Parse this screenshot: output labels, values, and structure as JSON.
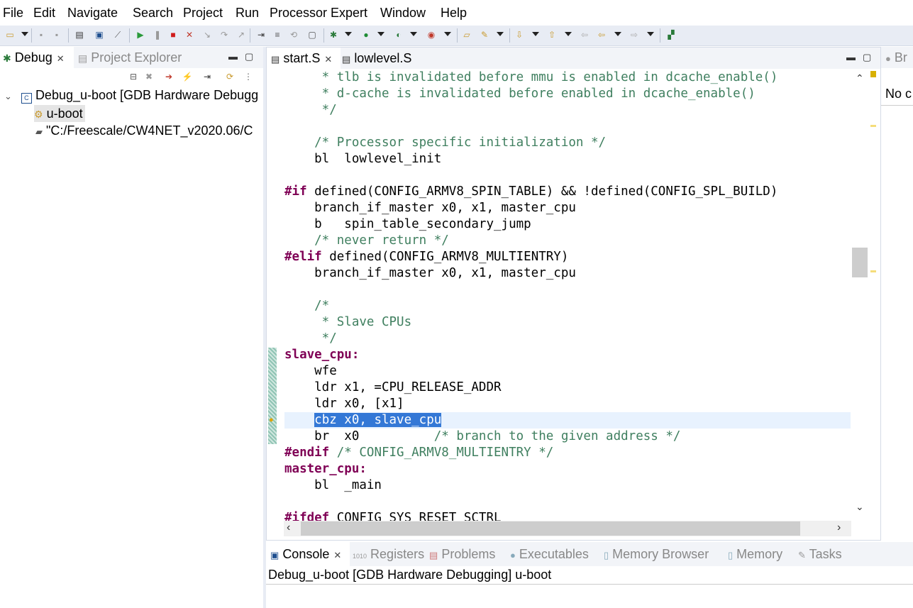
{
  "menu": [
    "File",
    "Edit",
    "Navigate",
    "Search",
    "Project",
    "Run",
    "Processor Expert",
    "Window",
    "Help"
  ],
  "debug_view": {
    "tabs": [
      {
        "label": "Debug",
        "active": true
      },
      {
        "label": "Project Explorer",
        "active": false
      }
    ],
    "tree": {
      "launch": "Debug_u-boot [GDB Hardware Debugg",
      "process": "u-boot",
      "path": "\"C:/Freescale/CW4NET_v2020.06/C"
    }
  },
  "editor": {
    "tabs": [
      {
        "label": "start.S",
        "active": true
      },
      {
        "label": "lowlevel.S",
        "active": false
      }
    ],
    "lines": [
      {
        "parts": [
          {
            "t": "     * tlb is invalidated before mmu is enabled in dcache_enable()",
            "c": "cm"
          }
        ]
      },
      {
        "parts": [
          {
            "t": "     * d-cache is invalidated before enabled in dcache_enable()",
            "c": "cm"
          }
        ]
      },
      {
        "parts": [
          {
            "t": "     */",
            "c": "cm"
          }
        ]
      },
      {
        "parts": []
      },
      {
        "parts": [
          {
            "t": "    /* Processor specific initialization */",
            "c": "cm"
          }
        ]
      },
      {
        "parts": [
          {
            "t": "    bl  lowlevel_init",
            "c": ""
          }
        ]
      },
      {
        "parts": []
      },
      {
        "parts": [
          {
            "t": "#if",
            "c": "pp"
          },
          {
            "t": " defined(CONFIG_ARMV8_SPIN_TABLE) && !defined(CONFIG_SPL_BUILD)",
            "c": ""
          }
        ]
      },
      {
        "parts": [
          {
            "t": "    branch_if_master x0, x1, master_cpu",
            "c": ""
          }
        ]
      },
      {
        "parts": [
          {
            "t": "    b   spin_table_secondary_jump",
            "c": ""
          }
        ]
      },
      {
        "parts": [
          {
            "t": "    /* never return */",
            "c": "cm"
          }
        ]
      },
      {
        "parts": [
          {
            "t": "#elif",
            "c": "pp"
          },
          {
            "t": " defined(CONFIG_ARMV8_MULTIENTRY)",
            "c": ""
          }
        ]
      },
      {
        "parts": [
          {
            "t": "    branch_if_master x0, x1, master_cpu",
            "c": ""
          }
        ]
      },
      {
        "parts": []
      },
      {
        "parts": [
          {
            "t": "    /*",
            "c": "cm"
          }
        ]
      },
      {
        "parts": [
          {
            "t": "     * Slave CPUs",
            "c": "cm"
          }
        ]
      },
      {
        "parts": [
          {
            "t": "     */",
            "c": "cm"
          }
        ]
      },
      {
        "parts": [
          {
            "t": "slave_cpu:",
            "c": "lb"
          }
        ]
      },
      {
        "parts": [
          {
            "t": "    wfe",
            "c": ""
          }
        ]
      },
      {
        "parts": [
          {
            "t": "    ldr x1, =CPU_RELEASE_ADDR",
            "c": ""
          }
        ]
      },
      {
        "parts": [
          {
            "t": "    ldr x0, [x1]",
            "c": ""
          }
        ]
      },
      {
        "parts": [
          {
            "t": "    ",
            "c": ""
          },
          {
            "t": "cbz x0, slave_cpu",
            "c": "hl"
          }
        ]
      },
      {
        "parts": [
          {
            "t": "    br  x0          ",
            "c": ""
          },
          {
            "t": "/* branch to the given address */",
            "c": "cm"
          }
        ]
      },
      {
        "parts": [
          {
            "t": "#endif",
            "c": "pp"
          },
          {
            "t": " ",
            "c": ""
          },
          {
            "t": "/* CONFIG_ARMV8_MULTIENTRY */",
            "c": "cm"
          }
        ]
      },
      {
        "parts": [
          {
            "t": "master_cpu:",
            "c": "lb"
          }
        ]
      },
      {
        "parts": [
          {
            "t": "    bl  _main",
            "c": ""
          }
        ]
      },
      {
        "parts": []
      },
      {
        "parts": [
          {
            "t": "#ifdef",
            "c": "pp"
          },
          {
            "t": " CONFIG_SYS_RESET_SCTRL",
            "c": ""
          }
        ]
      }
    ],
    "current_line_index": 21
  },
  "right_view": {
    "tab_label": "Br",
    "content": "No c"
  },
  "console": {
    "tabs": [
      {
        "label": "Console",
        "active": true,
        "icon": "console-icon"
      },
      {
        "label": "Registers",
        "active": false,
        "icon": "registers-icon"
      },
      {
        "label": "Problems",
        "active": false,
        "icon": "problems-icon"
      },
      {
        "label": "Executables",
        "active": false,
        "icon": "executables-icon"
      },
      {
        "label": "Memory Browser",
        "active": false,
        "icon": "memory-browser-icon"
      },
      {
        "label": "Memory",
        "active": false,
        "icon": "memory-icon"
      },
      {
        "label": "Tasks",
        "active": false,
        "icon": "tasks-icon"
      }
    ],
    "header": "Debug_u-boot [GDB Hardware Debugging] u-boot"
  },
  "colors": {
    "comment": "#3f7f5f",
    "keyword": "#7f0055",
    "selection": "#3478d6",
    "current_line": "#e8f2fe"
  }
}
